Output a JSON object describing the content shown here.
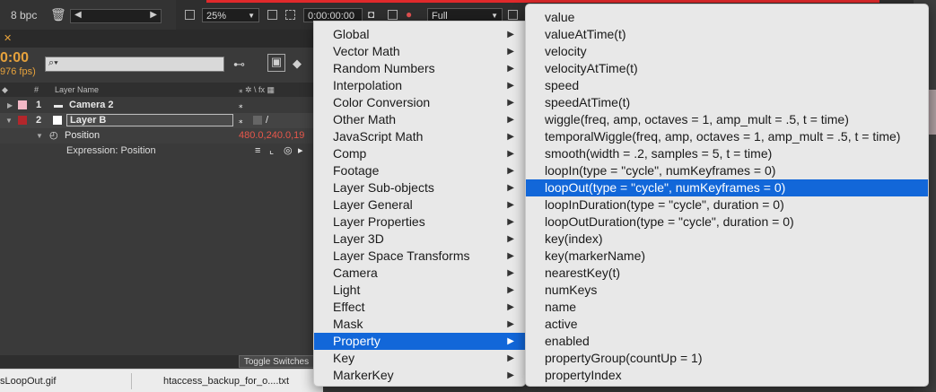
{
  "project_panel": {
    "bpc": "8 bpc"
  },
  "viewer_bar": {
    "zoom": "25%",
    "timecode": "0:00:00:00",
    "resolution": "Full"
  },
  "timeline": {
    "time": "0:00",
    "fps": "976 fps)",
    "col_hash": "#",
    "col_layer_name": "Layer Name",
    "layers": [
      {
        "num": "1",
        "name": "Camera 2",
        "color": "#f2b8c6"
      },
      {
        "num": "2",
        "name": "Layer B",
        "color": "#b3262b"
      }
    ],
    "position_label": "Position",
    "position_value": "480.0,240.0,19",
    "expression_label": "Expression: Position",
    "toggle_switches": "Toggle Switches"
  },
  "taskbar": {
    "file1": "sLoopOut.gif",
    "file2": "htaccess_backup_for_o....txt"
  },
  "menu_main": {
    "items": [
      "Global",
      "Vector Math",
      "Random Numbers",
      "Interpolation",
      "Color Conversion",
      "Other Math",
      "JavaScript Math",
      "Comp",
      "Footage",
      "Layer Sub-objects",
      "Layer General",
      "Layer Properties",
      "Layer 3D",
      "Layer Space Transforms",
      "Camera",
      "Light",
      "Effect",
      "Mask",
      "Property",
      "Key",
      "MarkerKey"
    ],
    "selected_index": 18
  },
  "menu_sub": {
    "items": [
      "value",
      "valueAtTime(t)",
      "velocity",
      "velocityAtTime(t)",
      "speed",
      "speedAtTime(t)",
      "wiggle(freq, amp, octaves = 1, amp_mult = .5, t = time)",
      "temporalWiggle(freq, amp, octaves = 1, amp_mult = .5, t = time)",
      "smooth(width = .2, samples = 5, t = time)",
      "loopIn(type = \"cycle\", numKeyframes = 0)",
      "loopOut(type = \"cycle\", numKeyframes = 0)",
      "loopInDuration(type = \"cycle\", duration = 0)",
      "loopOutDuration(type = \"cycle\", duration = 0)",
      "key(index)",
      "key(markerName)",
      "nearestKey(t)",
      "numKeys",
      "name",
      "active",
      "enabled",
      "propertyGroup(countUp = 1)",
      "propertyIndex"
    ],
    "selected_index": 10
  },
  "colors": {
    "highlight": "#1267d9",
    "menu_bg": "#e8e8e8",
    "accent_orange": "#e6a23c",
    "value_red": "#e8574b"
  }
}
